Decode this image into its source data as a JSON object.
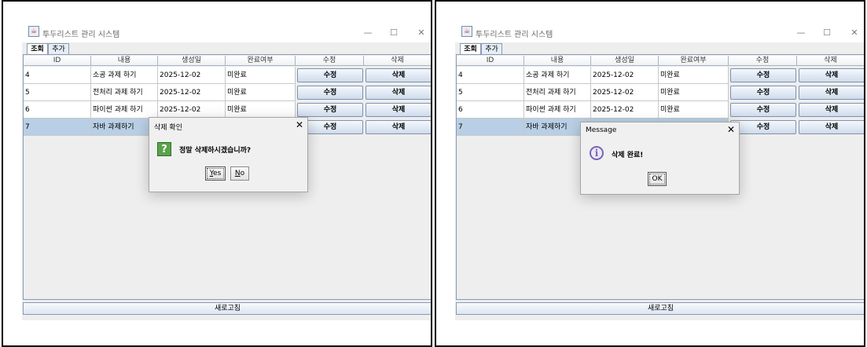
{
  "window": {
    "title": "투두리스트 관리 시스템",
    "minimize_icon": "minimize-icon",
    "maximize_icon": "maximize-icon",
    "close_icon": "close-icon",
    "minimize_glyph": "—",
    "maximize_glyph": "☐",
    "close_glyph": "✕"
  },
  "tabs": [
    {
      "label": "조회",
      "selected": true
    },
    {
      "label": "추가",
      "selected": false
    }
  ],
  "table": {
    "columns": [
      "ID",
      "내용",
      "생성일",
      "완료여부",
      "수정",
      "삭제"
    ],
    "rows": [
      {
        "id": "4",
        "content": "소공 과제 하기",
        "created": "2025-12-02",
        "status": "미완료",
        "edit": "수정",
        "delete": "삭제"
      },
      {
        "id": "5",
        "content": "전처리 과제 하기",
        "created": "2025-12-02",
        "status": "미완료",
        "edit": "수정",
        "delete": "삭제"
      },
      {
        "id": "6",
        "content": "파이썬 과제 하기",
        "created": "2025-12-02",
        "status": "미완료",
        "edit": "수정",
        "delete": "삭제"
      },
      {
        "id": "7",
        "content": "자바 과제하기",
        "created": "",
        "status": "",
        "edit": "수정",
        "delete": "삭제",
        "selected": true
      }
    ]
  },
  "refresh_label": "새로고침",
  "confirm_dialog": {
    "title": "삭제 확인",
    "message": "정말 삭제하시겠습니까?",
    "yes_mnemonic": "Y",
    "yes_rest": "es",
    "no_mnemonic": "N",
    "no_rest": "o",
    "icon": "question-icon",
    "icon_glyph": "?",
    "close_glyph": "✕"
  },
  "message_dialog": {
    "title": "Message",
    "message": "삭제 완료!",
    "ok": "OK",
    "icon": "info-icon",
    "icon_glyph": "i",
    "close_glyph": "✕"
  },
  "colors": {
    "selected_row": "#b8cfe5",
    "question_icon": "#5aa34a",
    "info_icon": "#7a64b6"
  }
}
